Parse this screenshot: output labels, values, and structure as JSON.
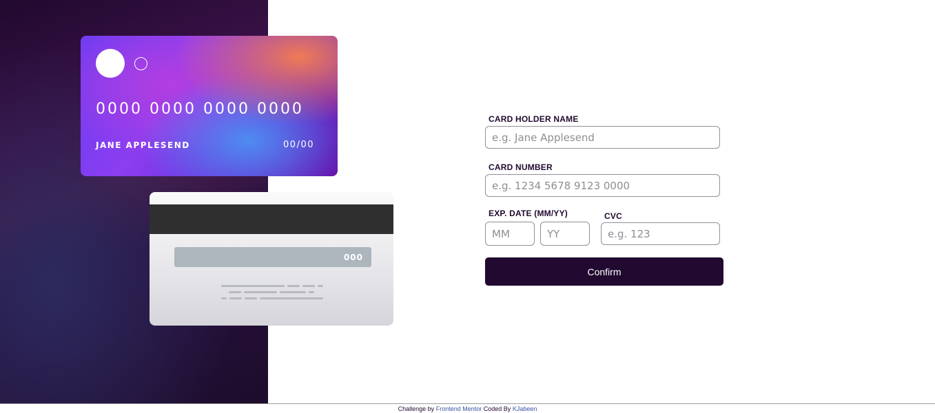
{
  "card_front": {
    "number": "0000 0000 0000 0000",
    "name": "JANE APPLESEND",
    "expiry": "00/00"
  },
  "card_back": {
    "cvc": "000"
  },
  "form": {
    "cardholder_label": "CARD HOLDER NAME",
    "cardholder_placeholder": "e.g. Jane Applesend",
    "cardnumber_label": "CARD NUMBER",
    "cardnumber_placeholder": "e.g. 1234 5678 9123 0000",
    "expdate_label": "EXP. DATE (MM/YY)",
    "month_placeholder": "MM",
    "year_placeholder": "YY",
    "cvc_label": "CVC",
    "cvc_placeholder": "e.g. 123",
    "confirm_label": "Confirm"
  },
  "footer": {
    "challenge_prefix": "Challenge by",
    "challenge_link": "Frontend Mentor",
    "coded_prefix": "Coded By",
    "author_link": "KJabeen"
  },
  "colors": {
    "dark_violet": "#21092f",
    "link": "#3e52a3"
  }
}
